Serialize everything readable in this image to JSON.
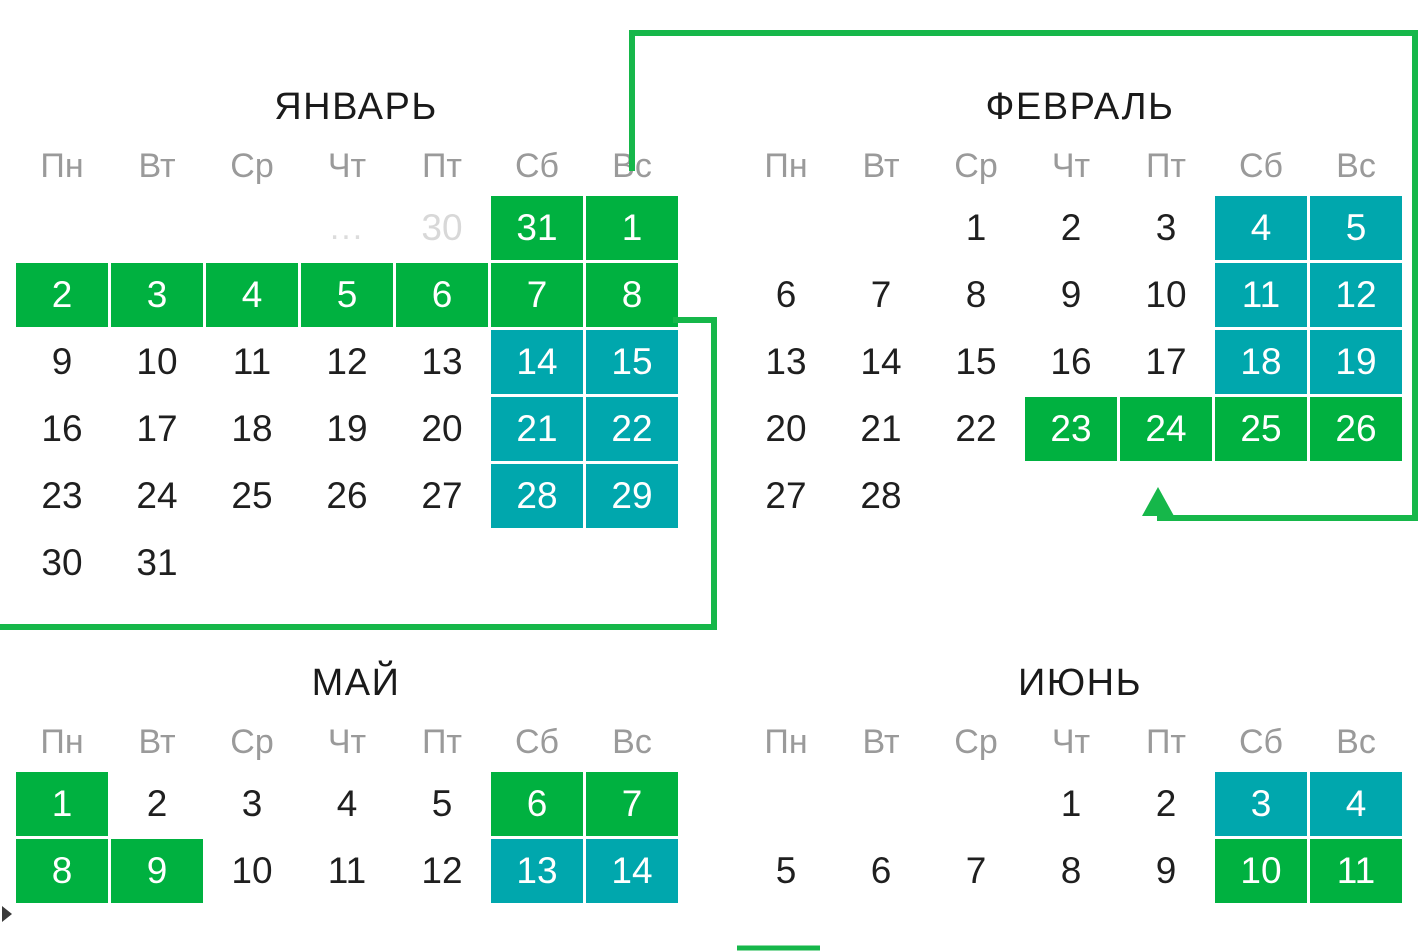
{
  "page": {
    "background": "#ffffff",
    "accent_green": "#00B140",
    "accent_teal": "#00A7AD",
    "weekday_color": "#9a9a9a",
    "muted_color": "#d8d8d8",
    "text_color": "#1f1f1f"
  },
  "weekdays": [
    "Пн",
    "Вт",
    "Ср",
    "Чт",
    "Пт",
    "Сб",
    "Вс"
  ],
  "months": [
    {
      "name": "january",
      "title": "ЯНВАРЬ",
      "rows": [
        [
          {
            "text": "",
            "style": "empty"
          },
          {
            "text": "",
            "style": "empty"
          },
          {
            "text": "",
            "style": "empty"
          },
          {
            "text": "...",
            "style": "dots"
          },
          {
            "text": "30",
            "style": "muted"
          },
          {
            "text": "31",
            "style": "green"
          },
          {
            "text": "1",
            "style": "green"
          }
        ],
        [
          {
            "text": "2",
            "style": "green"
          },
          {
            "text": "3",
            "style": "green"
          },
          {
            "text": "4",
            "style": "green"
          },
          {
            "text": "5",
            "style": "green"
          },
          {
            "text": "6",
            "style": "green"
          },
          {
            "text": "7",
            "style": "green"
          },
          {
            "text": "8",
            "style": "green"
          }
        ],
        [
          {
            "text": "9",
            "style": "plain"
          },
          {
            "text": "10",
            "style": "plain"
          },
          {
            "text": "11",
            "style": "plain"
          },
          {
            "text": "12",
            "style": "plain"
          },
          {
            "text": "13",
            "style": "plain"
          },
          {
            "text": "14",
            "style": "teal"
          },
          {
            "text": "15",
            "style": "teal"
          }
        ],
        [
          {
            "text": "16",
            "style": "plain"
          },
          {
            "text": "17",
            "style": "plain"
          },
          {
            "text": "18",
            "style": "plain"
          },
          {
            "text": "19",
            "style": "plain"
          },
          {
            "text": "20",
            "style": "plain"
          },
          {
            "text": "21",
            "style": "teal"
          },
          {
            "text": "22",
            "style": "teal"
          }
        ],
        [
          {
            "text": "23",
            "style": "plain"
          },
          {
            "text": "24",
            "style": "plain"
          },
          {
            "text": "25",
            "style": "plain"
          },
          {
            "text": "26",
            "style": "plain"
          },
          {
            "text": "27",
            "style": "plain"
          },
          {
            "text": "28",
            "style": "teal"
          },
          {
            "text": "29",
            "style": "teal"
          }
        ],
        [
          {
            "text": "30",
            "style": "plain"
          },
          {
            "text": "31",
            "style": "plain"
          },
          {
            "text": "",
            "style": "empty"
          },
          {
            "text": "",
            "style": "empty"
          },
          {
            "text": "",
            "style": "empty"
          },
          {
            "text": "",
            "style": "empty"
          },
          {
            "text": "",
            "style": "empty"
          }
        ]
      ]
    },
    {
      "name": "february",
      "title": "ФЕВРАЛЬ",
      "rows": [
        [
          {
            "text": "",
            "style": "empty"
          },
          {
            "text": "",
            "style": "empty"
          },
          {
            "text": "1",
            "style": "plain"
          },
          {
            "text": "2",
            "style": "plain"
          },
          {
            "text": "3",
            "style": "plain"
          },
          {
            "text": "4",
            "style": "teal"
          },
          {
            "text": "5",
            "style": "teal"
          }
        ],
        [
          {
            "text": "6",
            "style": "plain"
          },
          {
            "text": "7",
            "style": "plain"
          },
          {
            "text": "8",
            "style": "plain"
          },
          {
            "text": "9",
            "style": "plain"
          },
          {
            "text": "10",
            "style": "plain"
          },
          {
            "text": "11",
            "style": "teal"
          },
          {
            "text": "12",
            "style": "teal"
          }
        ],
        [
          {
            "text": "13",
            "style": "plain"
          },
          {
            "text": "14",
            "style": "plain"
          },
          {
            "text": "15",
            "style": "plain"
          },
          {
            "text": "16",
            "style": "plain"
          },
          {
            "text": "17",
            "style": "plain"
          },
          {
            "text": "18",
            "style": "teal"
          },
          {
            "text": "19",
            "style": "teal"
          }
        ],
        [
          {
            "text": "20",
            "style": "plain"
          },
          {
            "text": "21",
            "style": "plain"
          },
          {
            "text": "22",
            "style": "plain"
          },
          {
            "text": "23",
            "style": "green"
          },
          {
            "text": "24",
            "style": "green"
          },
          {
            "text": "25",
            "style": "green"
          },
          {
            "text": "26",
            "style": "green"
          }
        ],
        [
          {
            "text": "27",
            "style": "plain"
          },
          {
            "text": "28",
            "style": "plain"
          },
          {
            "text": "",
            "style": "empty"
          },
          {
            "text": "",
            "style": "empty"
          },
          {
            "text": "",
            "style": "empty"
          },
          {
            "text": "",
            "style": "empty"
          },
          {
            "text": "",
            "style": "empty"
          }
        ]
      ]
    },
    {
      "name": "may",
      "title": "МАЙ",
      "rows": [
        [
          {
            "text": "1",
            "style": "green"
          },
          {
            "text": "2",
            "style": "plain"
          },
          {
            "text": "3",
            "style": "plain"
          },
          {
            "text": "4",
            "style": "plain"
          },
          {
            "text": "5",
            "style": "plain"
          },
          {
            "text": "6",
            "style": "green"
          },
          {
            "text": "7",
            "style": "green"
          }
        ],
        [
          {
            "text": "8",
            "style": "green"
          },
          {
            "text": "9",
            "style": "green"
          },
          {
            "text": "10",
            "style": "plain"
          },
          {
            "text": "11",
            "style": "plain"
          },
          {
            "text": "12",
            "style": "plain"
          },
          {
            "text": "13",
            "style": "teal"
          },
          {
            "text": "14",
            "style": "teal"
          }
        ]
      ]
    },
    {
      "name": "june",
      "title": "ИЮНЬ",
      "rows": [
        [
          {
            "text": "",
            "style": "empty"
          },
          {
            "text": "",
            "style": "empty"
          },
          {
            "text": "",
            "style": "empty"
          },
          {
            "text": "1",
            "style": "plain"
          },
          {
            "text": "2",
            "style": "plain"
          },
          {
            "text": "3",
            "style": "teal"
          },
          {
            "text": "4",
            "style": "teal"
          }
        ],
        [
          {
            "text": "5",
            "style": "plain"
          },
          {
            "text": "6",
            "style": "plain"
          },
          {
            "text": "7",
            "style": "plain"
          },
          {
            "text": "8",
            "style": "plain"
          },
          {
            "text": "9",
            "style": "plain"
          },
          {
            "text": "10",
            "style": "green"
          },
          {
            "text": "11",
            "style": "green"
          }
        ]
      ]
    }
  ],
  "connectors": {
    "stroke": "#1DB954",
    "stroke_actual": "#16b74a",
    "width": 6,
    "description": "green routing lines linking january holiday block to february holiday block"
  }
}
